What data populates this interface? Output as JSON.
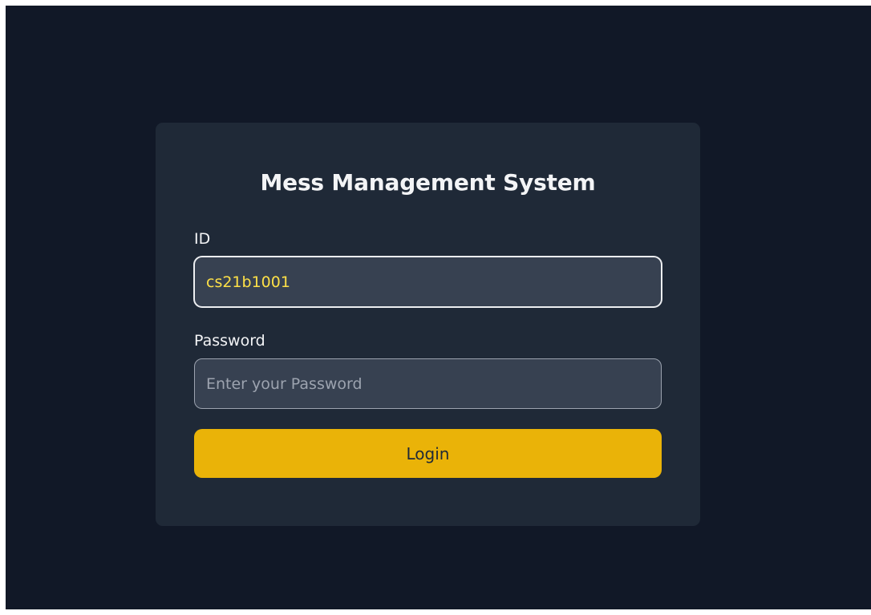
{
  "form": {
    "title": "Mess Management System",
    "id_label": "ID",
    "id_value": "cs21b1001",
    "password_label": "Password",
    "password_placeholder": "Enter your Password",
    "login_label": "Login"
  },
  "colors": {
    "background": "#111827",
    "card": "#1f2937",
    "input": "#374151",
    "accent": "#eab308",
    "input_text": "#fde047"
  }
}
